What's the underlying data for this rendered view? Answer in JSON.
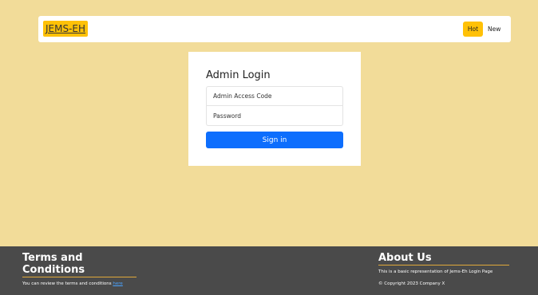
{
  "navbar": {
    "brand": "JEMS-EH",
    "items": [
      {
        "label": "Hot",
        "active": true
      },
      {
        "label": "New",
        "active": false
      }
    ],
    "accent_color": "#ffc107"
  },
  "login": {
    "title": "Admin Login",
    "access_code_placeholder": "Admin Access Code",
    "password_placeholder": "Password",
    "submit_label": "Sign in",
    "button_color": "#0d6efd"
  },
  "footer": {
    "terms": {
      "title": "Terms and Conditions",
      "text": "You can review the terms and conditions ",
      "link_text": "here"
    },
    "about": {
      "title": "About Us",
      "text": "This is a basic representation of Jems-Eh Login Page",
      "copyright": "© Copyright 2023 Company X"
    },
    "background_color": "#4a4a4a"
  },
  "page": {
    "background_color": "#f2dc99"
  }
}
